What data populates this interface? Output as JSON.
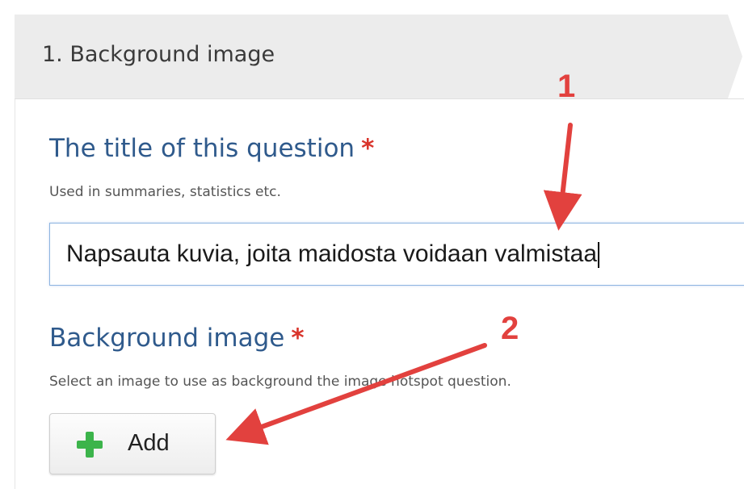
{
  "step": {
    "title": "1. Background image"
  },
  "question_title": {
    "label": "The title of this question",
    "required_mark": "*",
    "description": "Used in summaries, statistics etc.",
    "value": "Napsauta kuvia, joita maidosta voidaan valmistaa"
  },
  "background_image": {
    "label": "Background image",
    "required_mark": "*",
    "description": "Select an image to use as background the image hotspot question.",
    "add_button_label": "Add"
  },
  "annotations": {
    "callout_1": "1",
    "callout_2": "2",
    "color": "#e2413e"
  },
  "colors": {
    "label": "#2f5a8c",
    "required": "#d9342b",
    "add_icon": "#3cb44b",
    "header_bg": "#ececec"
  }
}
